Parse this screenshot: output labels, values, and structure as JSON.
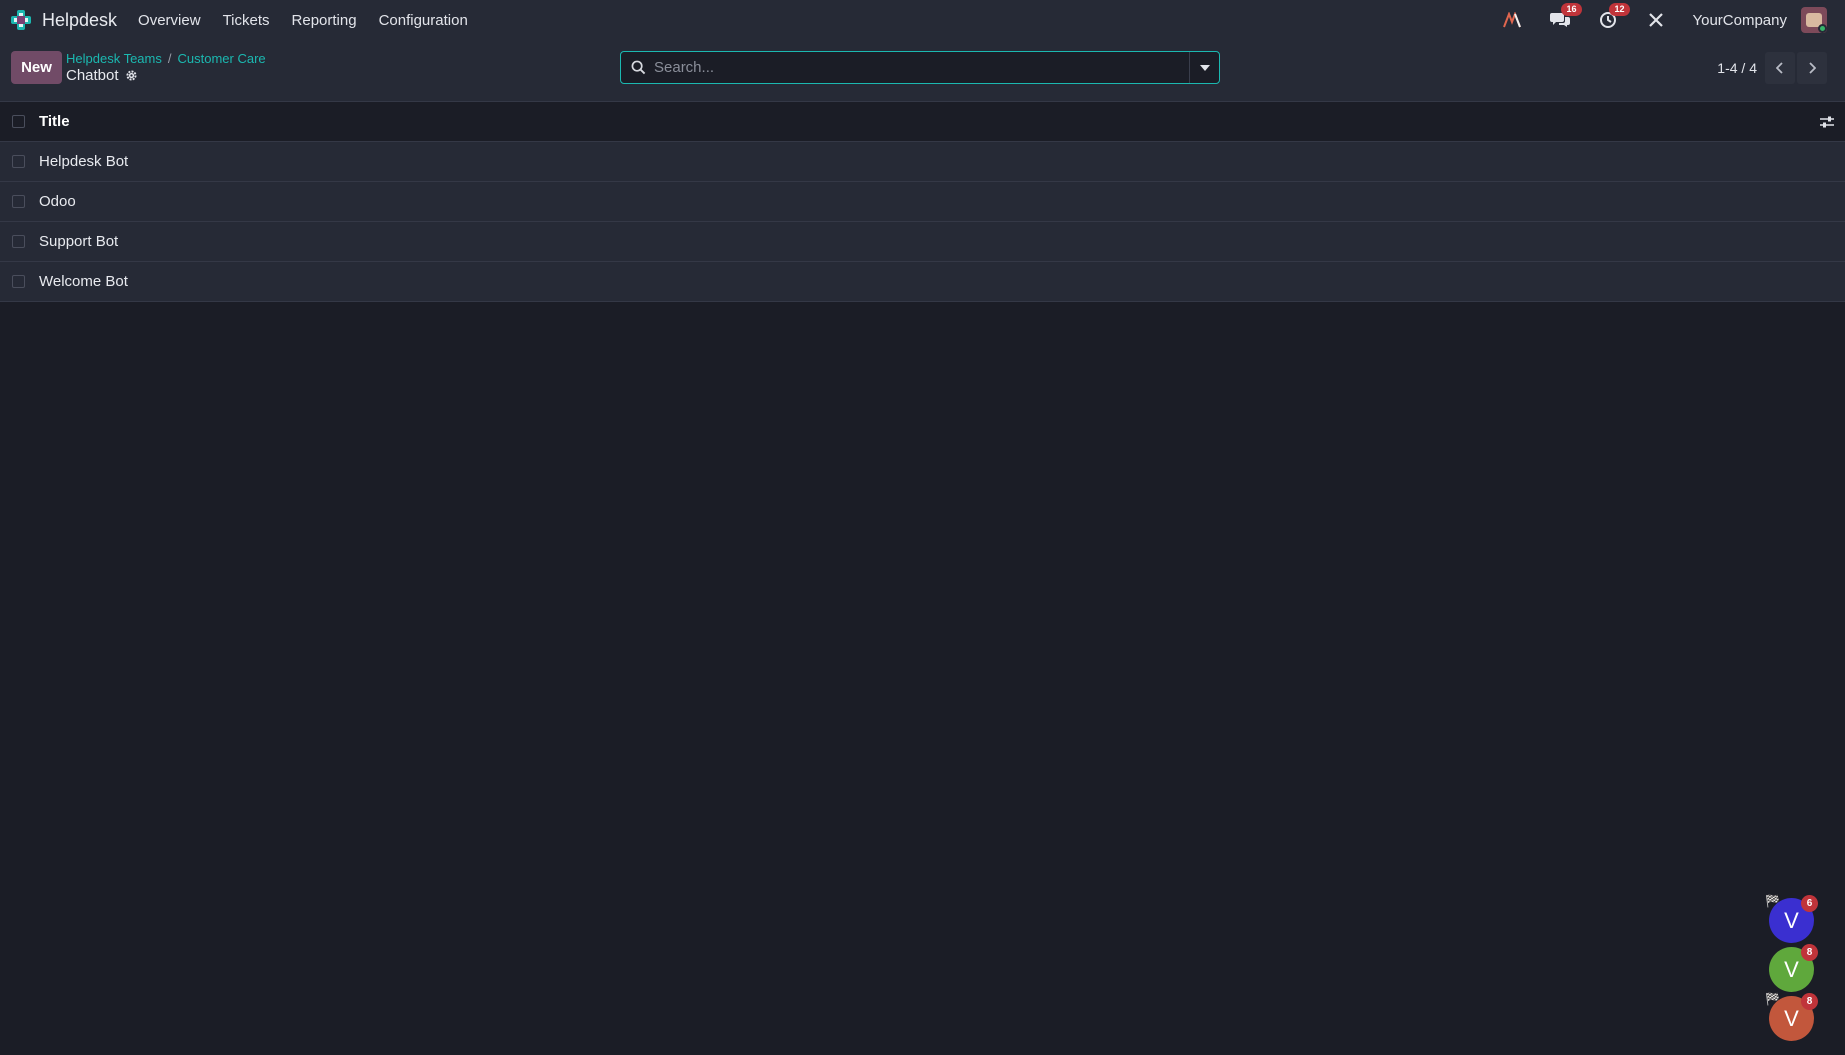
{
  "navbar": {
    "app_name": "Helpdesk",
    "menu": [
      "Overview",
      "Tickets",
      "Reporting",
      "Configuration"
    ],
    "messages_count": "16",
    "activities_count": "12",
    "company": "YourCompany"
  },
  "control_panel": {
    "new_label": "New",
    "breadcrumb": [
      "Helpdesk Teams",
      "Customer Care"
    ],
    "current": "Chatbot",
    "search_placeholder": "Search...",
    "pager": "1-4 / 4"
  },
  "list": {
    "header": "Title",
    "rows": [
      "Helpdesk Bot",
      "Odoo",
      "Support Bot",
      "Welcome Bot"
    ]
  },
  "chat_bubbles": [
    {
      "initial": "V",
      "count": "6",
      "color": "#3a2fd0"
    },
    {
      "initial": "V",
      "count": "8",
      "color": "#5fa83c"
    },
    {
      "initial": "V",
      "count": "8",
      "color": "#c2573c"
    }
  ],
  "colors": {
    "accent": "#1bb8b0",
    "primary_button": "#714b67",
    "badge": "#c0343a"
  }
}
